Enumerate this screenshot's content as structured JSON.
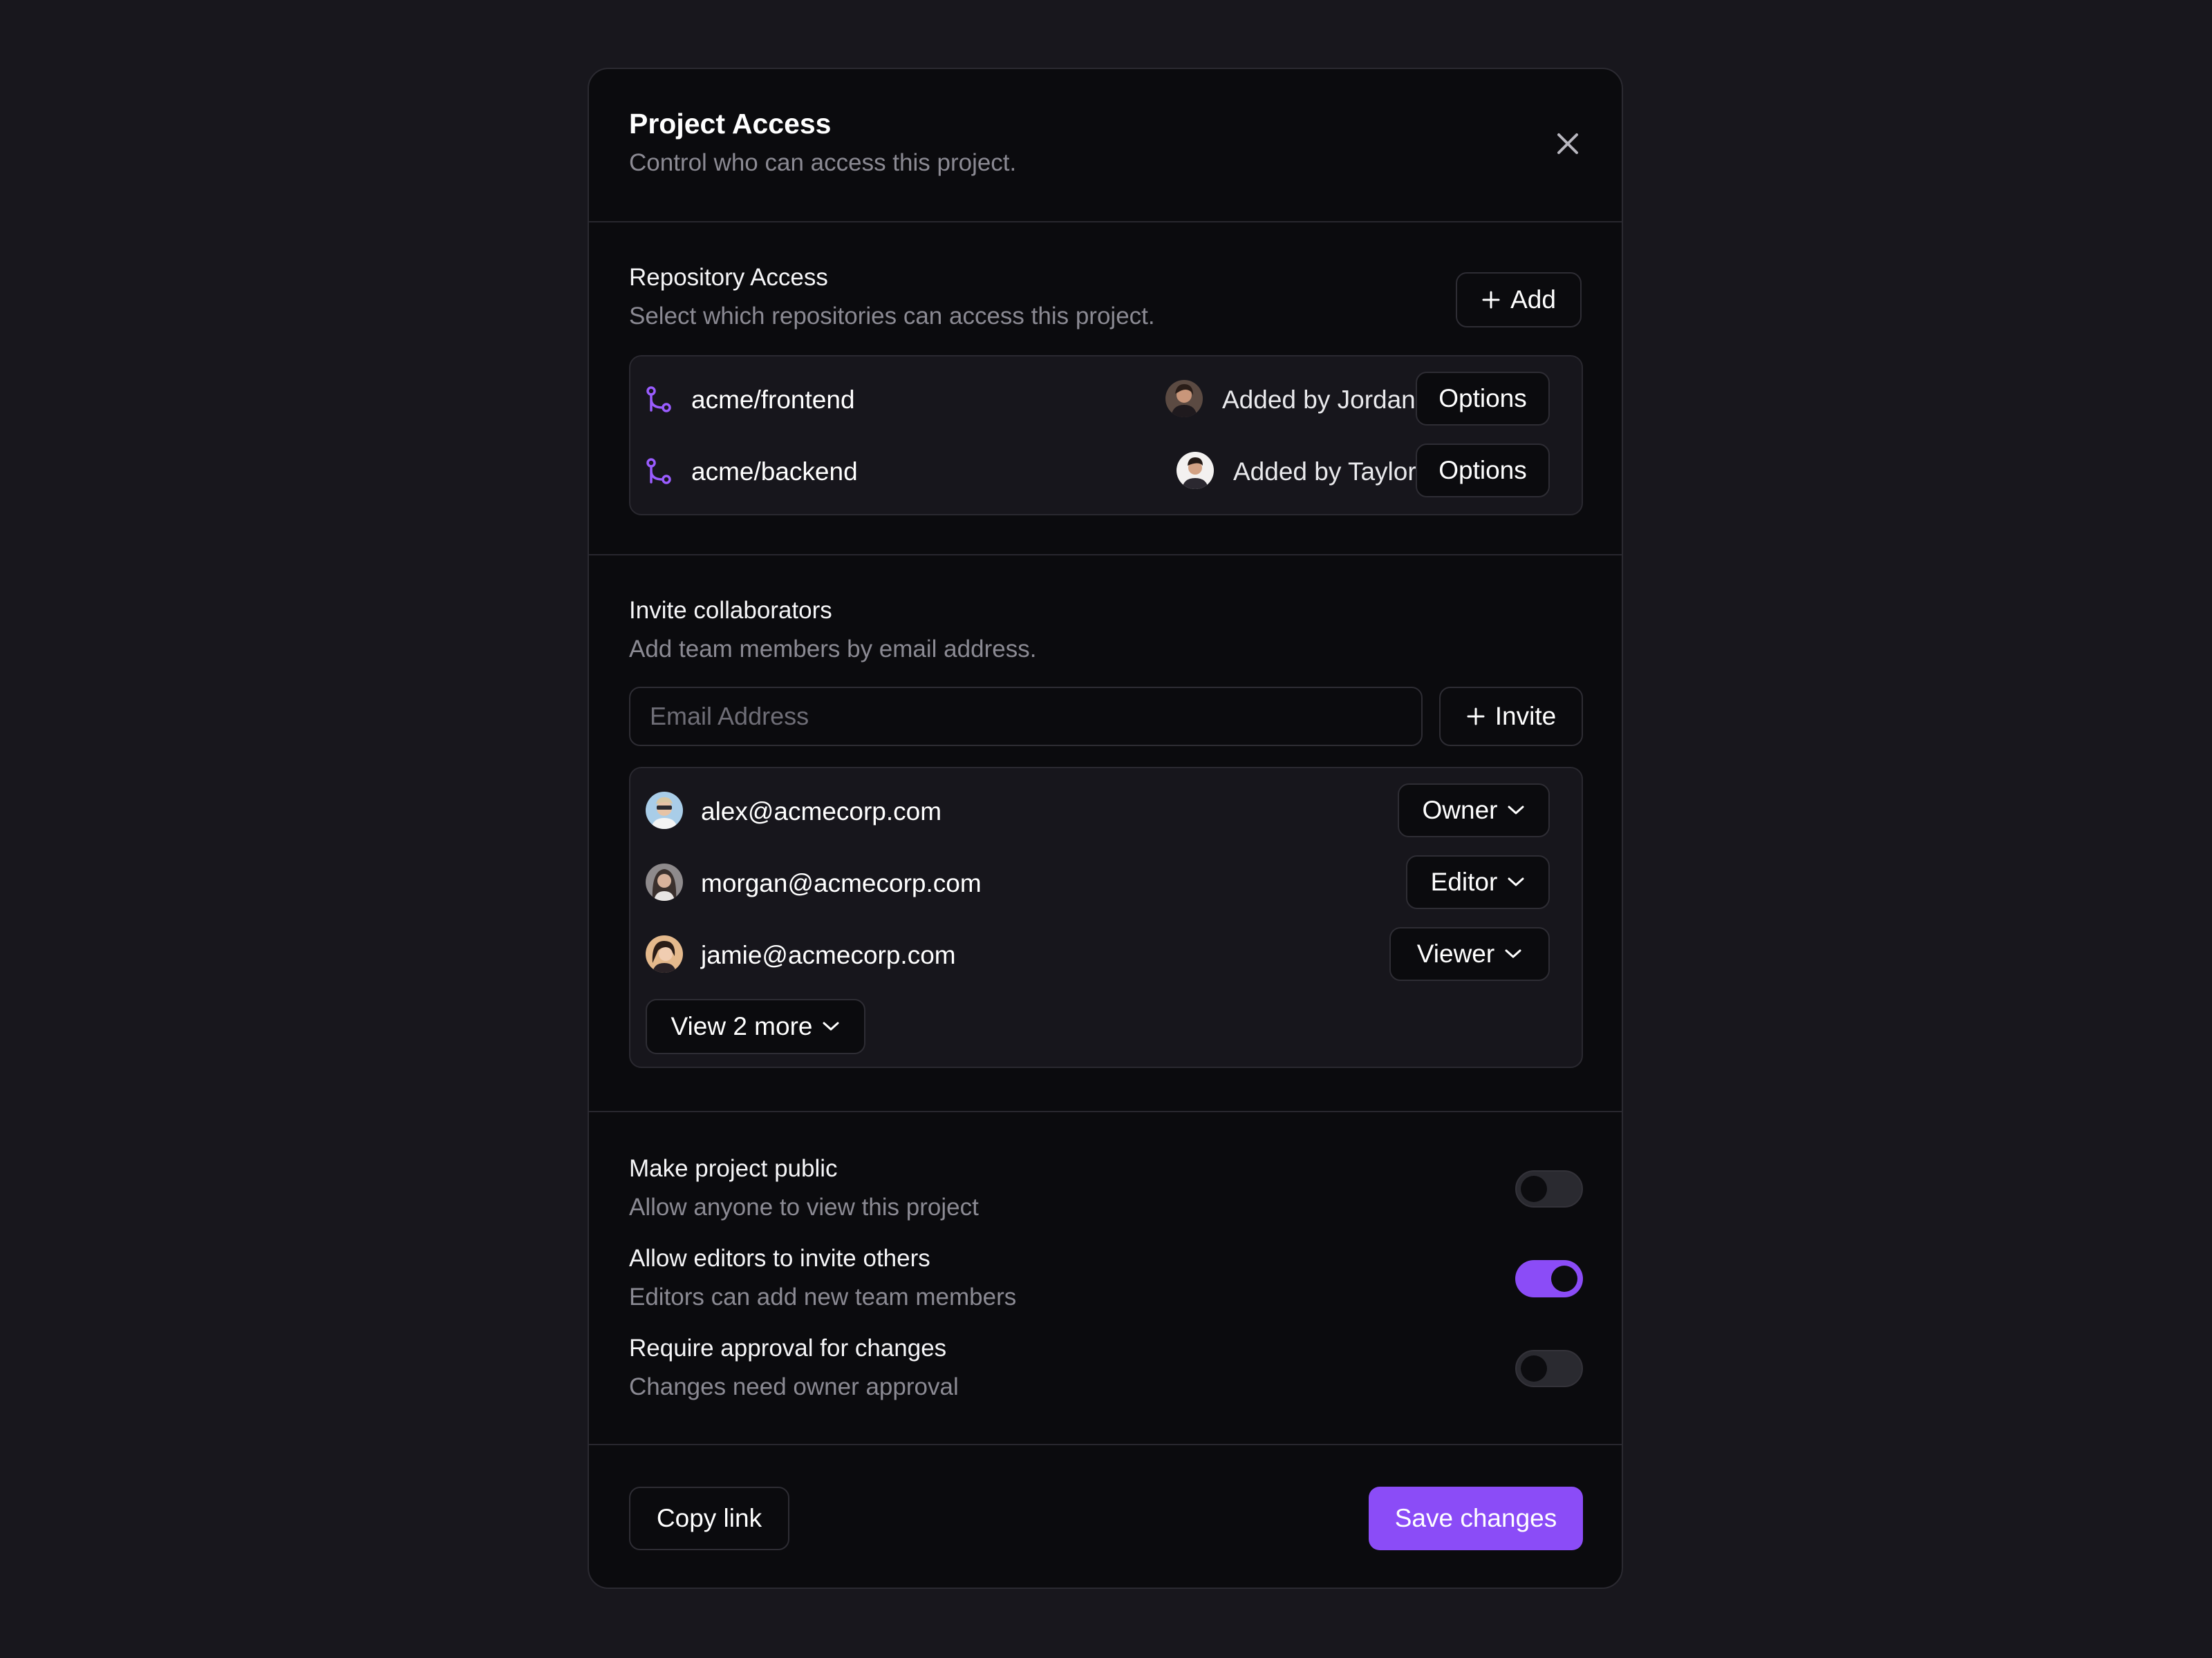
{
  "dialog": {
    "title": "Project Access",
    "subtitle": "Control who can access this project."
  },
  "repository": {
    "heading": "Repository Access",
    "description": "Select which repositories can access this project.",
    "add_label": "Add",
    "items": [
      {
        "name": "acme/frontend",
        "added_by": "Added by Jordan",
        "options_label": "Options"
      },
      {
        "name": "acme/backend",
        "added_by": "Added by Taylor",
        "options_label": "Options"
      }
    ]
  },
  "invite": {
    "heading": "Invite collaborators",
    "description": "Add team members by email address.",
    "email_placeholder": "Email Address",
    "invite_label": "Invite",
    "members": [
      {
        "email": "alex@acmecorp.com",
        "role": "Owner"
      },
      {
        "email": "morgan@acmecorp.com",
        "role": "Editor"
      },
      {
        "email": "jamie@acmecorp.com",
        "role": "Viewer"
      }
    ],
    "view_more_label": "View 2 more"
  },
  "settings": [
    {
      "label": "Make project public",
      "description": "Allow anyone to view this project",
      "enabled": false
    },
    {
      "label": "Allow editors to invite others",
      "description": "Editors can add new team members",
      "enabled": true
    },
    {
      "label": "Require approval for changes",
      "description": "Changes need owner approval",
      "enabled": false
    }
  ],
  "footer": {
    "copy_link_label": "Copy link",
    "save_label": "Save changes"
  },
  "colors": {
    "accent": "#8b4cf7",
    "background": "#18171d",
    "dialog": "#0b0b0e"
  },
  "icons": {
    "close": "close-icon",
    "plus": "plus-icon",
    "branch": "git-branch-icon",
    "chevron": "chevron-down-icon"
  }
}
